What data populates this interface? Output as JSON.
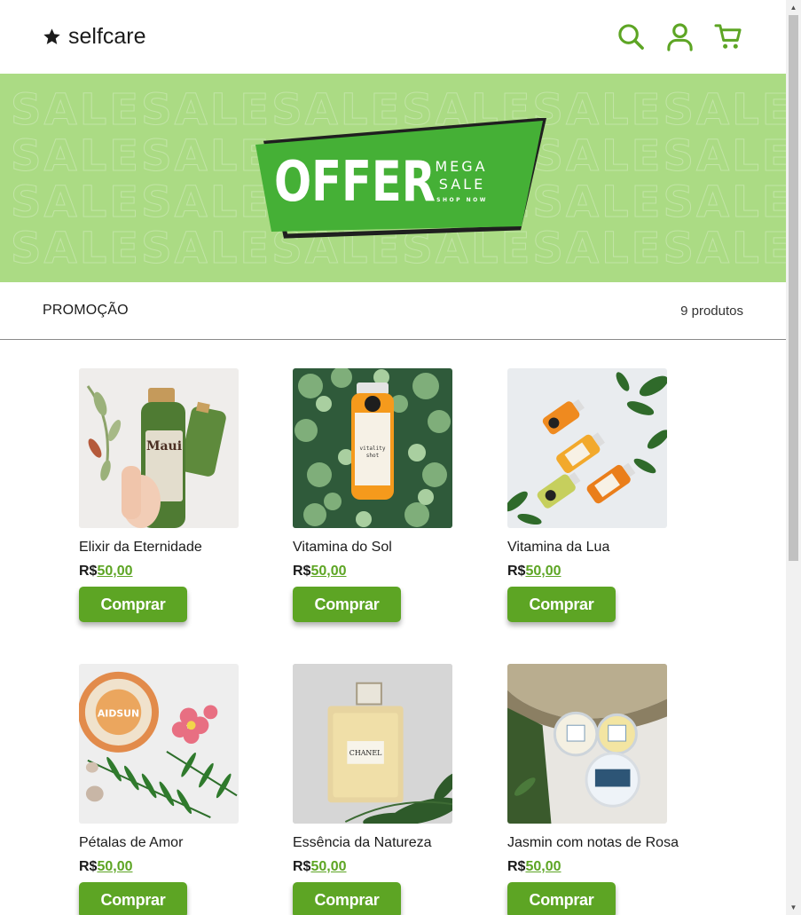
{
  "header": {
    "brand": "selfcare",
    "icons": [
      "search-icon",
      "user-icon",
      "cart-icon"
    ],
    "accent_color": "#5da524"
  },
  "banner": {
    "offer": "OFFER",
    "mega": "MEGA",
    "sale": "SALE",
    "shop_now": "SHOP NOW",
    "background_word": "SALE",
    "background_color": "#abdb84"
  },
  "section": {
    "title": "PROMOÇÃO",
    "count": "9 produtos"
  },
  "products": [
    {
      "name": "Elixir da Eternidade",
      "currency": "R$",
      "price": "50,00",
      "button": "Comprar"
    },
    {
      "name": "Vitamina do Sol",
      "currency": "R$",
      "price": "50,00",
      "button": "Comprar"
    },
    {
      "name": "Vitamina da Lua",
      "currency": "R$",
      "price": "50,00",
      "button": "Comprar"
    },
    {
      "name": "Pétalas de Amor",
      "currency": "R$",
      "price": "50,00",
      "button": "Comprar"
    },
    {
      "name": "Essência da Natureza",
      "currency": "R$",
      "price": "50,00",
      "button": "Comprar"
    },
    {
      "name": "Jasmin com notas de Rosa",
      "currency": "R$",
      "price": "50,00",
      "button": "Comprar"
    }
  ]
}
